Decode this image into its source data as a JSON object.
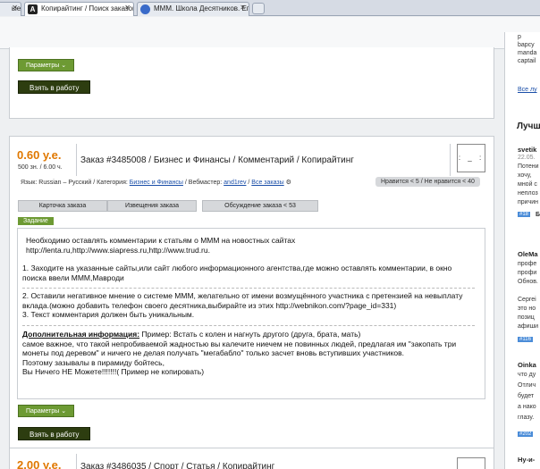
{
  "browser": {
    "tabs": [
      {
        "title": "ые",
        "favicon": "",
        "active": false
      },
      {
        "title": "Копирайтинг / Поиск заказов",
        "favicon": "A",
        "active": true
      },
      {
        "title": "МММ. Школа Десятников. Ег",
        "favicon": "",
        "active": false
      }
    ]
  },
  "prev_order": {
    "params_label": "Параметры",
    "work_label": "Взять в работу"
  },
  "order": {
    "price": "0.60 у.е.",
    "price_sub": "500 зн. / 6.00 ч.",
    "title": "Заказ #3485008 / Бизнес и Финансы / Комментарий / Копирайтинг",
    "avatar": ": _ :",
    "lang_label": "Язык:",
    "lang_value": "Russian – Русский",
    "cat_label": "Категория:",
    "cat_value": "Бизнес и Финансы",
    "webmaster_label": "Вебмастер:",
    "webmaster_value": "and1rev",
    "all_orders": "Все заказы",
    "rating": "Нравится  < 5  /  Не нравится  < 40",
    "tabs": [
      "Карточка заказа",
      "Извещения заказа",
      "Обсуждение заказа < 53"
    ],
    "task_label": "Задание",
    "task_intro": "Необходимо оставлять комментарии к статьям о МММ на новостных сайтах\nhttp://lenta.ru,http://www.siapress.ru,http://www.trud.ru.",
    "task_item1": "1. Заходите на указанные сайты,или сайт любого информационного агентства,где можно оставлять комментарии, в окно\nпоиска ввели МММ,Мавроди",
    "task_item2": "2. Оставили негативное мнение о системе МММ, желательно от имени возмущённого участника с претензией на невыплату\nвклада.(можно добавить телефон своего десятника,выбирайте из этих http://webnikon.com/?page_id=331)\n3. Текст комментария должен быть уникальным.",
    "extra_label": "Дополнительная информация:",
    "extra_text": " Пример: Встать с колен и нагнуть другого (друга, брата, мать)\nсамое важное, что такой непробиваемой жадностью вы калечите ниечем не повинных людей, предлагая им \"закопать три\nмонеты под деревом\" и ничего не делая получать \"мегабабло\" только засчет вновь вступивших участников.\nПоэтому зазывалы в пирамиду бойтесь,\nВы Ничего НЕ Можете!!!!!!!( Пример не копировать)",
    "params_label": "Параметры",
    "work_label": "Взять в работу"
  },
  "next_order": {
    "price": "2.00 у.е.",
    "title": "Заказ #3486035 / Спорт / Статья / Копирайтинг"
  },
  "sidebar": {
    "top_lines": [
      "р",
      "bapcy",
      "manda",
      "captail"
    ],
    "all_link": "Все лу",
    "heading": "Лучш",
    "entries": [
      {
        "name": "svetik",
        "date": "22.05.",
        "lines": [
          "Потени",
          "хочу,",
          "мной с",
          "неплоз",
          "причин"
        ],
        "badge": "#18",
        "badge_extra": "Б"
      },
      {
        "name": "OleMa",
        "date": "",
        "lines": [
          "профе",
          "профи",
          "Обнов."
        ],
        "badge": "",
        "badge_extra": ""
      },
      {
        "name": "",
        "date": "",
        "lines": [
          "Сергеі",
          "это но",
          "позиц",
          "афиши"
        ],
        "badge": "#116",
        "badge_extra": ""
      },
      {
        "name": "Oinka",
        "date": "",
        "lines": [
          "что ду",
          "Отлич",
          "будет",
          "а нако",
          "глазу."
        ],
        "badge": "#202",
        "badge_extra": ""
      },
      {
        "name": "Ну-и-",
        "date": "",
        "lines": [],
        "badge": "",
        "badge_extra": ""
      }
    ]
  }
}
